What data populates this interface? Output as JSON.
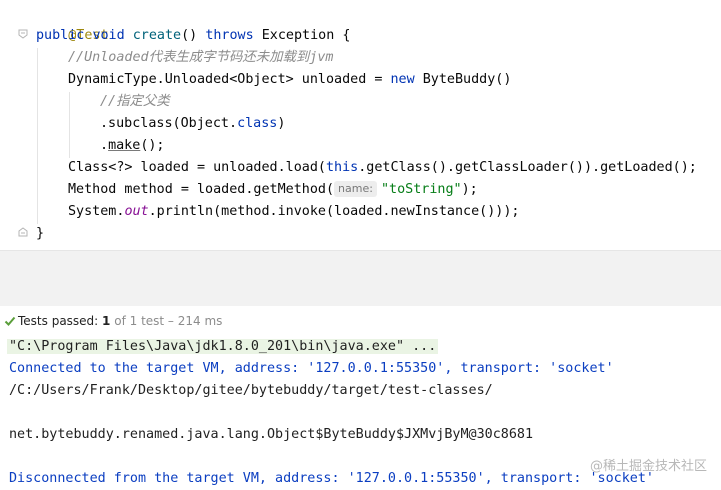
{
  "editor": {
    "fold_icon": "fold-marker-icon",
    "lines": {
      "l1": {
        "annotation": "@Test"
      },
      "l2": {
        "kw_public": "public",
        "kw_void": "void",
        "method": "create",
        "paren": "() ",
        "kw_throws": "throws",
        "rest": " Exception {"
      },
      "l3": {
        "comment": "//Unloaded代表生成字节码还未加载到jvm"
      },
      "l4": {
        "text_a": "DynamicType.Unloaded<Object> unloaded = ",
        "kw_new": "new",
        "text_b": " ByteBuddy()"
      },
      "l5": {
        "comment": "//指定父类"
      },
      "l6": {
        "text_a": ".subclass(Object.",
        "kw_class": "class",
        "text_b": ")"
      },
      "l7": {
        "text_a": ".",
        "make": "make",
        "text_b": "();"
      },
      "l8": {
        "text_a": "Class<?> loaded = unloaded.load(",
        "kw_this": "this",
        "text_b": ".getClass().getClassLoader()).getLoaded();"
      },
      "l9": {
        "text_a": "Method method = loaded.getMethod(",
        "hint": "name:",
        "string": "\"toString\"",
        "text_b": ");"
      },
      "l10": {
        "text_a": "System.",
        "static_field": "out",
        "text_b": ".println(method.invoke(loaded.newInstance()));"
      },
      "l11": {
        "text": "}"
      }
    }
  },
  "status": {
    "icon": "check-icon",
    "label": "Tests passed:",
    "count": "1",
    "detail": "of 1 test – 214 ms"
  },
  "console": {
    "lines": [
      "\"C:\\Program Files\\Java\\jdk1.8.0_201\\bin\\java.exe\" ...",
      "Connected to the target VM, address: '127.0.0.1:55350', transport: 'socket'",
      "/C:/Users/Frank/Desktop/gitee/bytebuddy/target/test-classes/",
      "net.bytebuddy.renamed.java.lang.Object$ByteBuddy$JXMvjByM@30c8681",
      "Disconnected from the target VM, address: '127.0.0.1:55350', transport: 'socket'"
    ]
  },
  "watermark": "@稀土掘金技术社区",
  "colors": {
    "keyword": "#0033b3",
    "annotation": "#9e880d",
    "string": "#067d17",
    "comment": "#8c8c8c",
    "console_blue": "#0b3ec1",
    "check_green": "#5a9e3a"
  }
}
